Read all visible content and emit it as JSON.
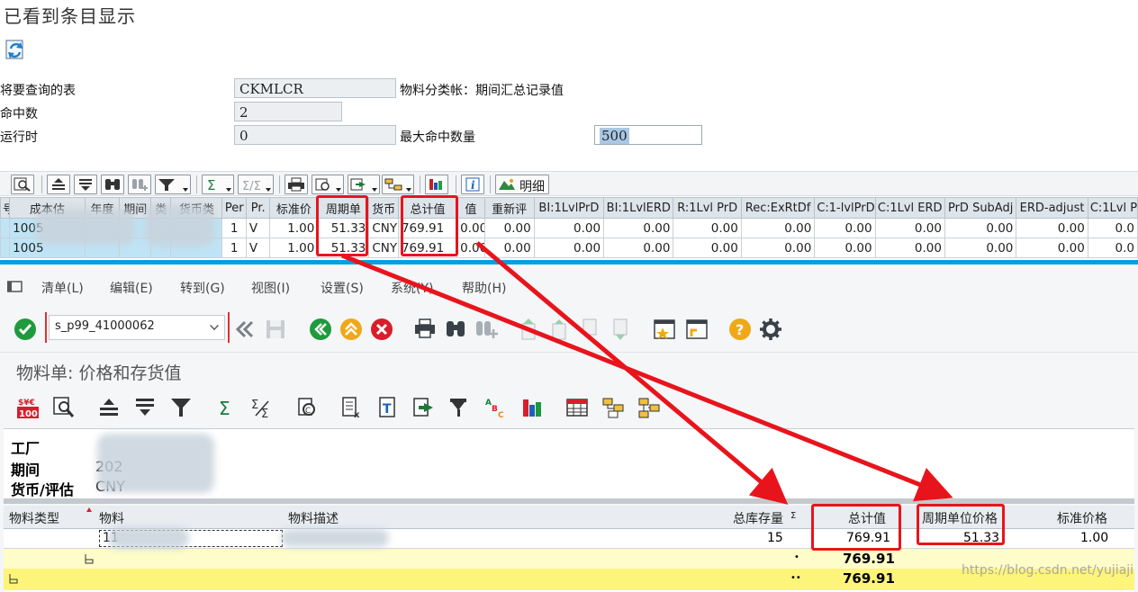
{
  "top": {
    "title": "已看到条目显示",
    "fields": {
      "table_label": "将要查询的表",
      "table_value": "CKMLCR",
      "table_desc": "物料分类帐：期间汇总记录值",
      "hits_label": "命中数",
      "hits_value": "2",
      "runtime_label": "运行时",
      "runtime_value": "0",
      "maxhits_label": "最大命中数量",
      "maxhits_value": "500"
    },
    "toolbar": {
      "detail_label": "明细"
    },
    "grid": {
      "headers": [
        "号",
        "成本估",
        "年度",
        "期间",
        "类",
        "货币类",
        "Per",
        "Pr.",
        "标准价",
        "周期单",
        "货币",
        "总计值",
        "值",
        "重新评",
        "BI:1LvlPrD",
        "BI:1LvlERD",
        "R:1Lvl PrD",
        "Rec:ExRtDf",
        "C:1-lvlPrD",
        "C:1Lvl ERD",
        "PrD SubAdj",
        "ERD-adjust",
        "C:1Lvl P"
      ],
      "rows": [
        [
          "",
          "1005",
          "",
          "",
          "",
          "",
          "1",
          "V",
          "1.00",
          "51.33",
          "CNY",
          "769.91",
          "0.00",
          "0.00",
          "0.00",
          "0.00",
          "0.00",
          "0.00",
          "0.00",
          "0.00",
          "0.00",
          "0.00",
          "0.0"
        ],
        [
          "",
          "1005",
          "",
          "",
          "",
          "",
          "1",
          "V",
          "1.00",
          "51.33",
          "CNY",
          "769.91",
          "0.00",
          "0.00",
          "0.00",
          "0.00",
          "0.00",
          "0.00",
          "0.00",
          "0.00",
          "0.00",
          "0.00",
          "0.0"
        ]
      ]
    }
  },
  "bottom": {
    "menu": [
      "清单(L)",
      "编辑(E)",
      "转到(G)",
      "视图(I)",
      "设置(S)",
      "系统(Y)",
      "帮助(H)"
    ],
    "command_field": "s_p99_41000062",
    "screen_title": "物料单: 价格和存货值",
    "info": {
      "plant_label": "工厂",
      "period_label": "期间",
      "period_value": "202",
      "currency_label": "货币/评估",
      "currency_value": "CNY"
    },
    "grid": {
      "headers": {
        "material_type": "物料类型",
        "material": "物料",
        "material_desc": "物料描述",
        "total_stock": "总库存量",
        "sigma": "Σ",
        "total_value": "总计值",
        "period_unit_price": "周期单位价格",
        "standard_price": "标准价格"
      },
      "row": {
        "material": "11",
        "total_stock": "15",
        "total_value": "769.91",
        "period_unit_price": "51.33",
        "standard_price": "1.00"
      },
      "subtotal": {
        "marker": "•",
        "value": "769.91"
      },
      "total": {
        "marker": "••",
        "value": "769.91"
      }
    }
  },
  "watermark": "https://blog.csdn.net/yujiaji",
  "colors": {
    "highlight": "#e8141c",
    "sap_blue_stripe": "#00a0e0",
    "subtotal_yellow": "#fefcc8",
    "total_yellow": "#fdf47a"
  }
}
